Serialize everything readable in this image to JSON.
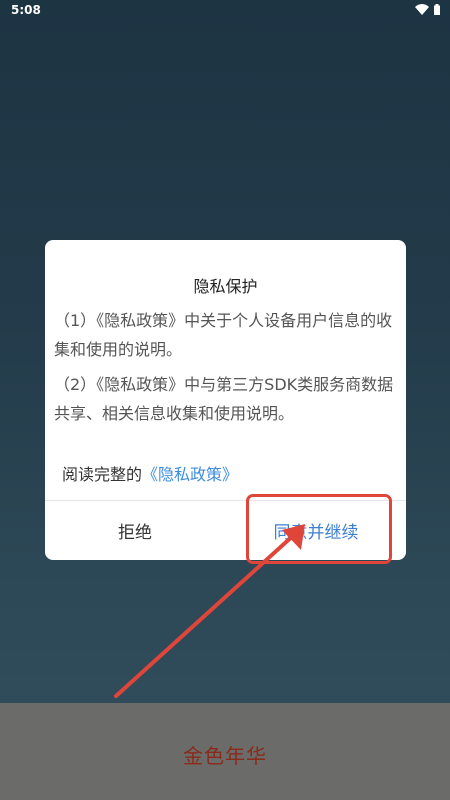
{
  "status_bar": {
    "time": "5:08"
  },
  "icons": {
    "wifi": "wifi-icon",
    "battery": "battery-icon"
  },
  "dialog": {
    "title": "隐私保护",
    "paragraphs": [
      "（1）《隐私政策》中关于个人设备用户信息的收集和使用的说明。",
      "（2）《隐私政策》中与第三方SDK类服务商数据共享、相关信息收集和使用说明。"
    ],
    "read_prefix": "阅读完整的",
    "policy_link": "《隐私政策》",
    "reject_label": "拒绝",
    "accept_label": "同意并继续"
  },
  "bottom_bar": {
    "title": "金色年华"
  },
  "colors": {
    "link": "#3c8de0",
    "accept": "#3c7fd0",
    "annotation": "#e0453a",
    "bottom_title": "#8a2a1a"
  }
}
